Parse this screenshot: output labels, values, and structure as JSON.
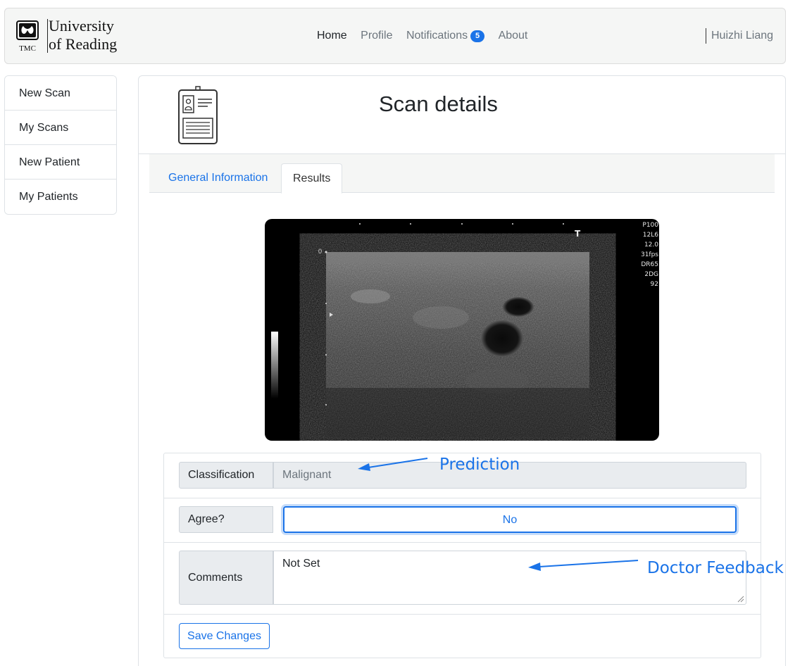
{
  "brand": {
    "line1": "University",
    "line2": "of Reading",
    "mark_text": "TMC"
  },
  "nav": {
    "items": [
      {
        "label": "Home",
        "active": true
      },
      {
        "label": "Profile",
        "active": false
      },
      {
        "label": "Notifications",
        "active": false
      },
      {
        "label": "About",
        "active": false
      }
    ],
    "notifications_count": "5",
    "user": "Huizhi Liang"
  },
  "sidebar": {
    "items": [
      {
        "label": "New Scan"
      },
      {
        "label": "My Scans"
      },
      {
        "label": "New Patient"
      },
      {
        "label": "My Patients"
      }
    ]
  },
  "page": {
    "title": "Scan details",
    "icon": "id-card-icon"
  },
  "tabs": [
    {
      "label": "General Information",
      "active": false
    },
    {
      "label": "Results",
      "active": true
    }
  ],
  "scan": {
    "meta": "P100\n12L6\n12.0\n31fps\nDR65\n2DG\n92",
    "depth_zero": "0",
    "marker": "T"
  },
  "form": {
    "classification_label": "Classification",
    "classification_value": "Malignant",
    "agree_label": "Agree?",
    "agree_value": "No",
    "comments_label": "Comments",
    "comments_value": "Not Set",
    "save_label": "Save Changes"
  },
  "annotations": {
    "prediction": "Prediction",
    "feedback": "Doctor Feedback"
  },
  "colors": {
    "accent": "#1a73e8",
    "navbar_bg": "#f5f6f5",
    "readonly_bg": "#e9ecef"
  }
}
